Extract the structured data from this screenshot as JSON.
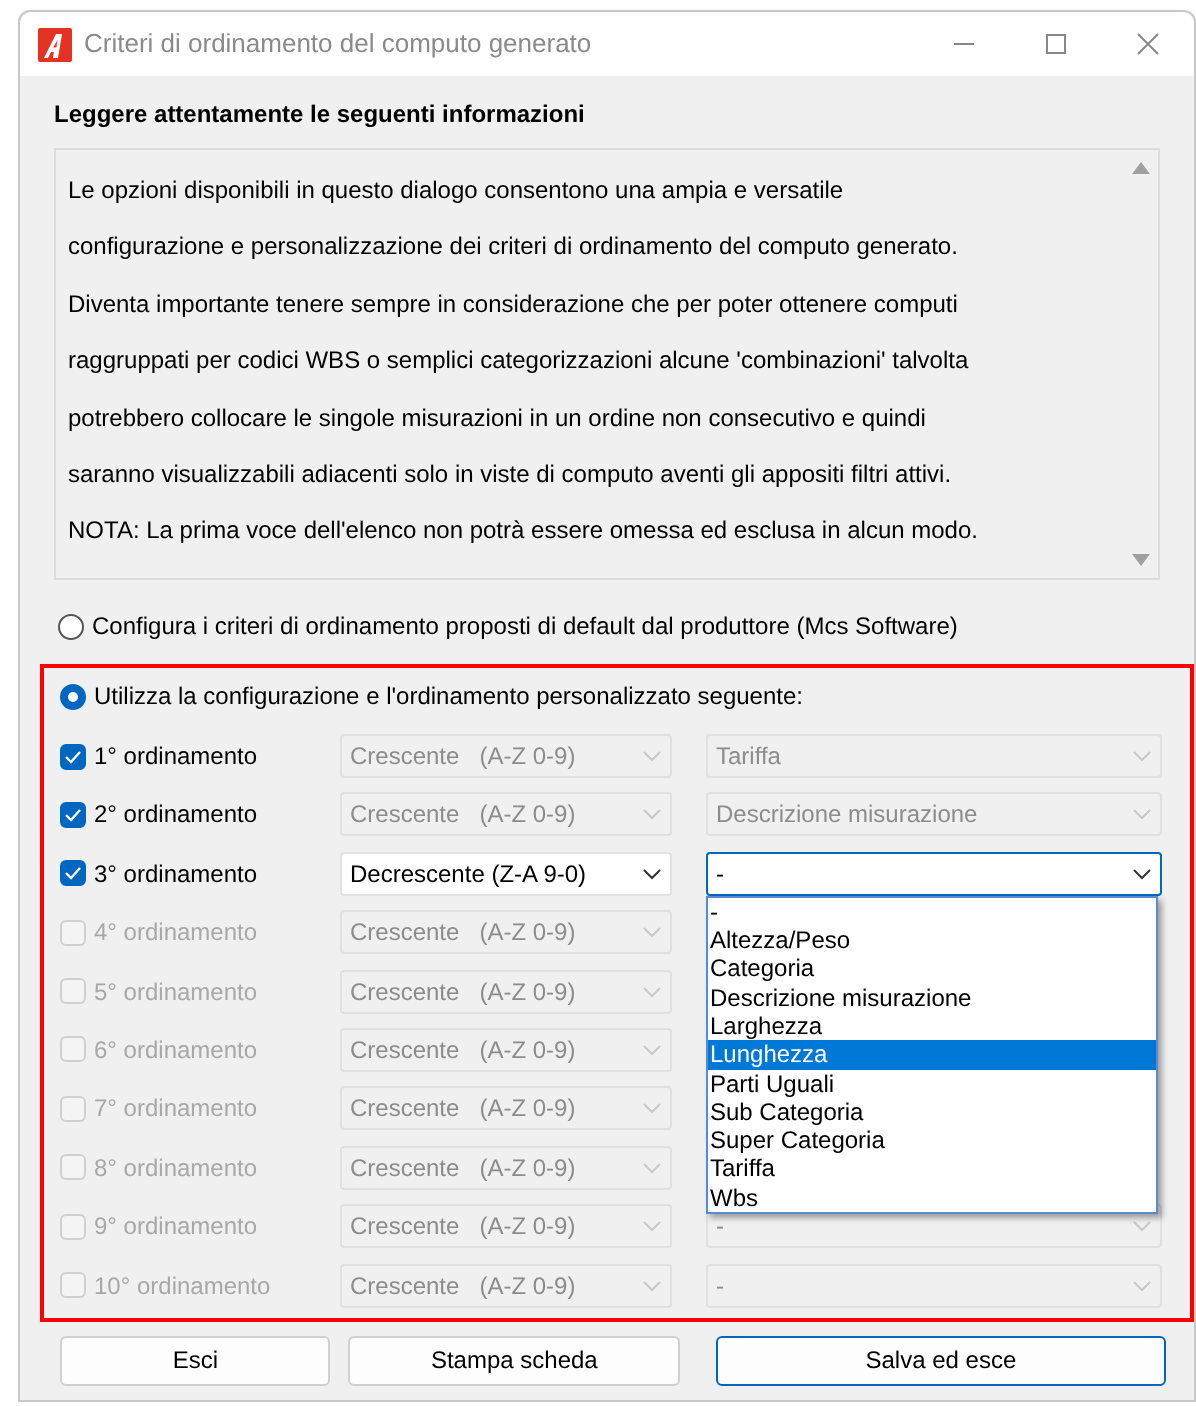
{
  "window": {
    "title": "Criteri di ordinamento del computo generato"
  },
  "info": {
    "heading": "Leggere attentamente le seguenti informazioni",
    "lines": [
      "Le opzioni disponibili in questo dialogo consentono una ampia e versatile",
      "configurazione e personalizzazione dei criteri di ordinamento del computo generato.",
      "Diventa importante tenere sempre in considerazione che per poter ottenere computi",
      "raggruppati per codici WBS o semplici categorizzazioni alcune 'combinazioni' talvolta",
      "potrebbero collocare le singole misurazioni in un ordine non consecutivo e quindi",
      "saranno visualizzabili adiacenti solo in viste di computo aventi gli appositi filtri attivi.",
      "NOTA: La prima voce dell'elenco non potrà essere omessa ed esclusa in alcun modo."
    ]
  },
  "options": [
    {
      "label": "Configura i criteri di ordinamento proposti di default dal produttore (Mcs Software)",
      "selected": false
    },
    {
      "label": "Utilizza la configurazione e l'ordinamento personalizzato seguente:",
      "selected": true
    }
  ],
  "sort_rows": [
    {
      "label": "1° ordinamento",
      "checked": true,
      "disabled": false,
      "editable": false,
      "order": "Crescente   (A-Z 0-9)",
      "field": "Tariffa",
      "open": false
    },
    {
      "label": "2° ordinamento",
      "checked": true,
      "disabled": false,
      "editable": false,
      "order": "Crescente   (A-Z 0-9)",
      "field": "Descrizione misurazione",
      "open": false
    },
    {
      "label": "3° ordinamento",
      "checked": true,
      "disabled": false,
      "editable": true,
      "order": "Decrescente (Z-A 9-0)",
      "field": "-",
      "open": true
    },
    {
      "label": "4° ordinamento",
      "checked": false,
      "disabled": true,
      "editable": false,
      "order": "Crescente   (A-Z 0-9)"
    },
    {
      "label": "5° ordinamento",
      "checked": false,
      "disabled": true,
      "editable": false,
      "order": "Crescente   (A-Z 0-9)"
    },
    {
      "label": "6° ordinamento",
      "checked": false,
      "disabled": true,
      "editable": false,
      "order": "Crescente   (A-Z 0-9)"
    },
    {
      "label": "7° ordinamento",
      "checked": false,
      "disabled": true,
      "editable": false,
      "order": "Crescente   (A-Z 0-9)"
    },
    {
      "label": "8° ordinamento",
      "checked": false,
      "disabled": true,
      "editable": false,
      "order": "Crescente   (A-Z 0-9)"
    },
    {
      "label": "9° ordinamento",
      "checked": false,
      "disabled": true,
      "editable": false,
      "order": "Crescente   (A-Z 0-9)",
      "field": "-",
      "open": false
    },
    {
      "label": "10° ordinamento",
      "checked": false,
      "disabled": true,
      "editable": false,
      "order": "Crescente   (A-Z 0-9)",
      "field": "-",
      "open": false
    }
  ],
  "dropdown": {
    "items": [
      {
        "label": "-",
        "selected": false
      },
      {
        "label": "Altezza/Peso",
        "selected": false
      },
      {
        "label": "Categoria",
        "selected": false
      },
      {
        "label": "Descrizione misurazione",
        "selected": false
      },
      {
        "label": "Larghezza",
        "selected": false
      },
      {
        "label": "Lunghezza",
        "selected": true
      },
      {
        "label": "Parti Uguali",
        "selected": false
      },
      {
        "label": "Sub Categoria",
        "selected": false
      },
      {
        "label": "Super Categoria",
        "selected": false
      },
      {
        "label": "Tariffa",
        "selected": false
      },
      {
        "label": "Wbs",
        "selected": false
      }
    ]
  },
  "buttons": [
    {
      "label": "Esci",
      "focused": false
    },
    {
      "label": "Stampa scheda",
      "focused": false
    },
    {
      "label": "Salva ed esce",
      "focused": true
    }
  ]
}
